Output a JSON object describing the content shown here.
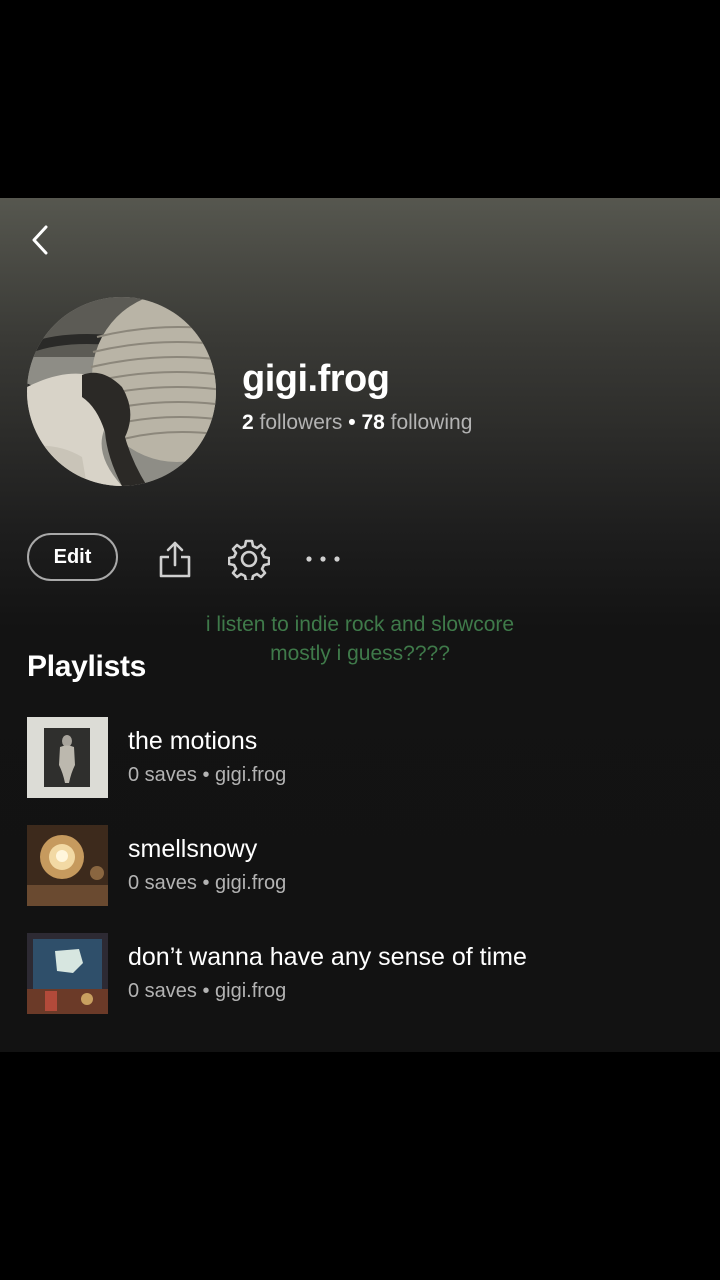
{
  "profile": {
    "username": "gigi.frog",
    "followers_count": "2",
    "followers_label": "followers",
    "separator": "•",
    "following_count": "78",
    "following_label": "following",
    "bio": "i listen to indie rock and slowcore mostly i guess????"
  },
  "actions": {
    "edit_label": "Edit",
    "share_icon": "share-icon",
    "settings_icon": "gear-icon",
    "more_icon": "more-horizontal-icon"
  },
  "nav": {
    "back_icon": "chevron-left-icon"
  },
  "playlists_section": {
    "title": "Playlists",
    "items": [
      {
        "name": "the motions",
        "meta": "0 saves • gigi.frog"
      },
      {
        "name": "smellsnowy",
        "meta": "0 saves • gigi.frog"
      },
      {
        "name": "don’t wanna have any sense of time",
        "meta": "0 saves • gigi.frog"
      }
    ]
  },
  "colors": {
    "background": "#121212",
    "header_gradient_top": "#56574f",
    "bio_text": "#3f7a4a",
    "secondary_text": "#b3b3b3"
  }
}
